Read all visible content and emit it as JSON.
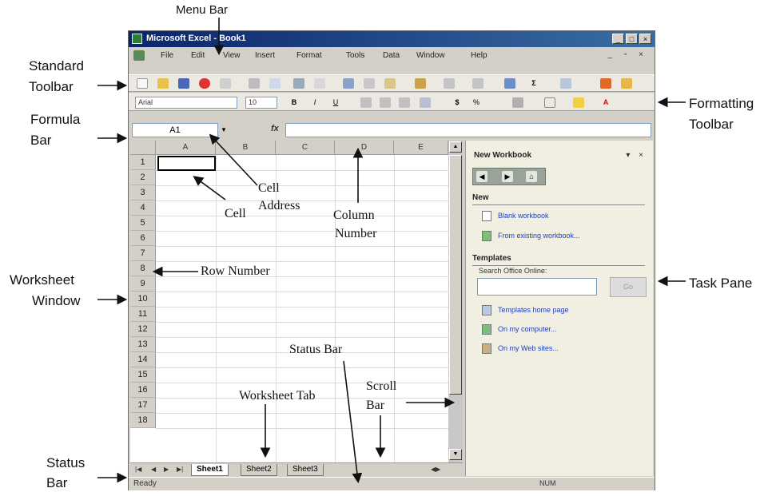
{
  "window": {
    "title": "Microsoft Excel - Book1",
    "controls": [
      "_",
      "□",
      "×"
    ]
  },
  "menu": {
    "items": [
      "File",
      "Edit",
      "View",
      "Insert",
      "Format",
      "Tools",
      "Data",
      "Window",
      "Help"
    ],
    "doc_controls": "_ ▫ ×"
  },
  "formatting": {
    "font": "Arial",
    "size": "10",
    "buttons": [
      "B",
      "I",
      "U"
    ]
  },
  "formula_bar": {
    "name_box": "A1",
    "fx": "fx"
  },
  "grid": {
    "columns": [
      "A",
      "B",
      "C",
      "D",
      "E"
    ],
    "rows": [
      "1",
      "2",
      "3",
      "4",
      "5",
      "6",
      "7",
      "8",
      "9",
      "10",
      "11",
      "12",
      "13",
      "14",
      "15",
      "16",
      "17",
      "18"
    ]
  },
  "task_pane": {
    "title": "New Workbook",
    "controls": "▾ ×",
    "new_section": "New",
    "new_links": [
      "Blank workbook",
      "From existing workbook..."
    ],
    "templates_section": "Templates",
    "search_label": "Search Office Online:",
    "go": "Go",
    "template_links": [
      "Templates home page",
      "On my computer...",
      "On my Web sites..."
    ]
  },
  "sheet_tabs": [
    "Sheet1",
    "Sheet2",
    "Sheet3"
  ],
  "status_bar": {
    "text": "Ready",
    "num": "NUM"
  },
  "annotations": {
    "menu_bar": "Menu Bar",
    "standard_toolbar_1": "Standard",
    "standard_toolbar_2": "Toolbar",
    "formula_bar_1": "Formula",
    "formula_bar_2": "Bar",
    "formatting_toolbar_1": "Formatting",
    "formatting_toolbar_2": "Toolbar",
    "worksheet_window_1": "Worksheet",
    "worksheet_window_2": "Window",
    "status_bar_1": "Status",
    "status_bar_2": "Bar",
    "task_pane": "Task Pane",
    "cell": "Cell",
    "cell_address_1": "Cell",
    "cell_address_2": "Address",
    "column_number_1": "Column",
    "column_number_2": "Number",
    "row_number": "Row Number",
    "status_bar_inner": "Status Bar",
    "worksheet_tab": "Worksheet Tab",
    "scroll_bar_1": "Scroll",
    "scroll_bar_2": "Bar"
  }
}
